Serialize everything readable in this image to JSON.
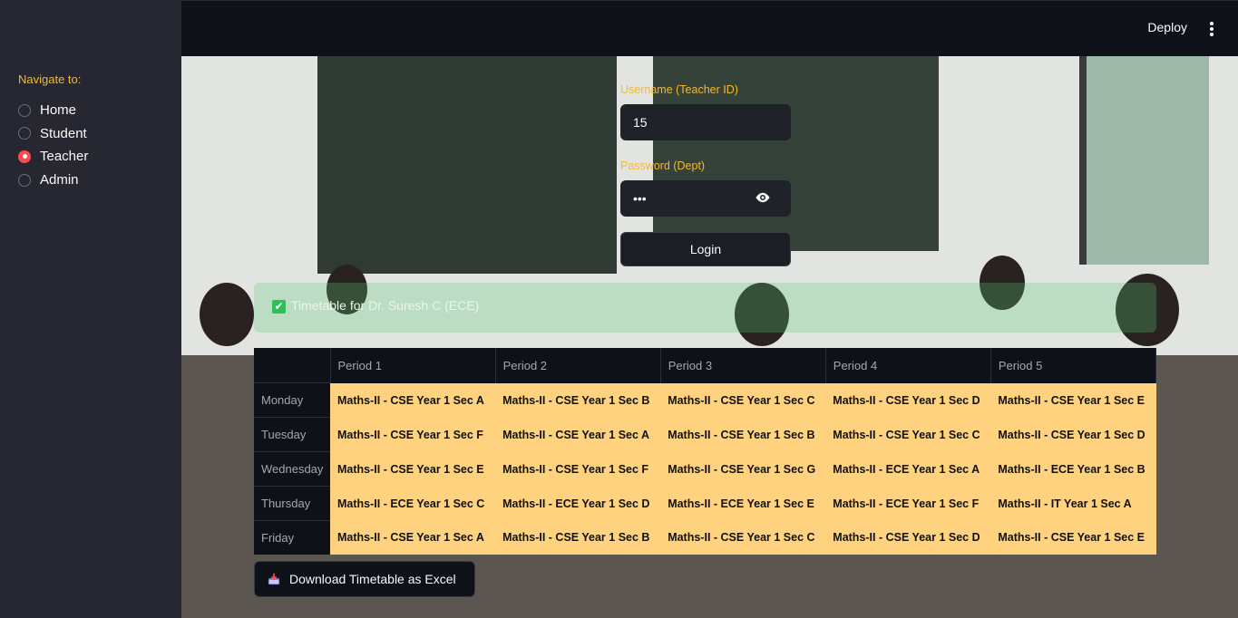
{
  "sidebar": {
    "nav_label": "Navigate to:",
    "options": [
      {
        "label": "Home",
        "selected": false
      },
      {
        "label": "Student",
        "selected": false
      },
      {
        "label": "Teacher",
        "selected": true
      },
      {
        "label": "Admin",
        "selected": false
      }
    ]
  },
  "header": {
    "deploy_label": "Deploy",
    "menu_icon": "kebab-menu-icon"
  },
  "login": {
    "username_label": "Username (Teacher ID)",
    "username_value": "15",
    "password_label": "Password (Dept)",
    "password_value": "•••",
    "password_toggle_icon": "eye-icon",
    "login_button": "Login"
  },
  "success": {
    "icon": "checkbox-icon",
    "text": "Timetable for Dr. Suresh C (ECE)"
  },
  "timetable": {
    "columns": [
      "",
      "Period 1",
      "Period 2",
      "Period 3",
      "Period 4",
      "Period 5"
    ],
    "rows": [
      {
        "day": "Monday",
        "cells": [
          "Maths-II - CSE Year 1 Sec A",
          "Maths-II - CSE Year 1 Sec B",
          "Maths-II - CSE Year 1 Sec C",
          "Maths-II - CSE Year 1 Sec D",
          "Maths-II - CSE Year 1 Sec E"
        ]
      },
      {
        "day": "Tuesday",
        "cells": [
          "Maths-II - CSE Year 1 Sec F",
          "Maths-II - CSE Year 1 Sec A",
          "Maths-II - CSE Year 1 Sec B",
          "Maths-II - CSE Year 1 Sec C",
          "Maths-II - CSE Year 1 Sec D"
        ]
      },
      {
        "day": "Wednesday",
        "cells": [
          "Maths-II - CSE Year 1 Sec E",
          "Maths-II - CSE Year 1 Sec F",
          "Maths-II - CSE Year 1 Sec G",
          "Maths-II - ECE Year 1 Sec A",
          "Maths-II - ECE Year 1 Sec B"
        ]
      },
      {
        "day": "Thursday",
        "cells": [
          "Maths-II - ECE Year 1 Sec C",
          "Maths-II - ECE Year 1 Sec D",
          "Maths-II - ECE Year 1 Sec E",
          "Maths-II - ECE Year 1 Sec F",
          "Maths-II - IT Year 1 Sec A"
        ]
      },
      {
        "day": "Friday",
        "cells": [
          "Maths-II - CSE Year 1 Sec A",
          "Maths-II - CSE Year 1 Sec B",
          "Maths-II - CSE Year 1 Sec C",
          "Maths-II - CSE Year 1 Sec D",
          "Maths-II - CSE Year 1 Sec E"
        ]
      }
    ]
  },
  "download": {
    "icon": "inbox-tray-icon",
    "label": "Download Timetable as Excel"
  },
  "colors": {
    "accent": "#ff4b4b",
    "label_gold": "#f5b82e",
    "cell_highlight": "#ffd27f",
    "success_green": "#2fbf56"
  }
}
